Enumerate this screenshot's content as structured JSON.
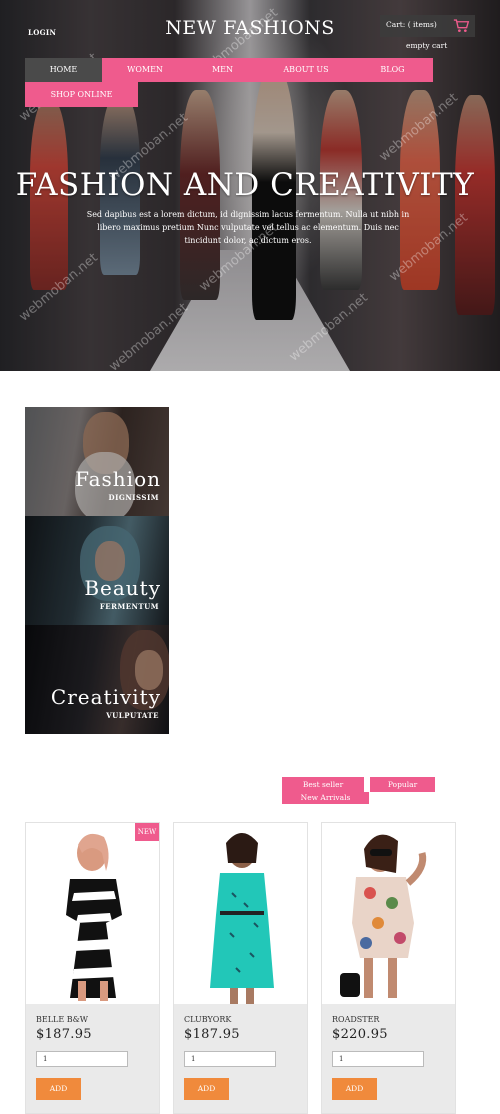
{
  "header": {
    "login": "LOGIN",
    "brand": "NEW FASHIONS",
    "cart_label": "Cart: ( items)",
    "cart_status": "empty cart"
  },
  "nav": {
    "items": [
      "HOME",
      "WOMEN",
      "MEN",
      "ABOUT US",
      "BLOG"
    ],
    "second_row": "SHOP ONLINE"
  },
  "hero": {
    "title": "FASHION AND CREATIVITY",
    "text": "Sed dapibus est a lorem dictum, id dignissim lacus fermentum. Nulla ut nibh in libero maximus pretium Nunc vulputate vel tellus ac elementum. Duis nec tincidunt dolor, ac dictum eros."
  },
  "categories": [
    {
      "title": "Fashion",
      "subtitle": "DIGNISSIM"
    },
    {
      "title": "Beauty",
      "subtitle": "FERMENTUM"
    },
    {
      "title": "Creativity",
      "subtitle": "VULPUTATE"
    }
  ],
  "tabs": {
    "best": "Best seller",
    "popular": "Popular",
    "new": "New Arrivals"
  },
  "products": [
    {
      "name": "BELLE B&W",
      "price": "$187.95",
      "qty": "1",
      "add": "ADD",
      "badge": "NEW"
    },
    {
      "name": "CLUBYORK",
      "price": "$187.95",
      "qty": "1",
      "add": "ADD"
    },
    {
      "name": "ROADSTER",
      "price": "$220.95",
      "qty": "1",
      "add": "ADD"
    }
  ],
  "watermark": "webmoban.net",
  "colors": {
    "accent": "#ef5b8d",
    "button": "#f08a3c",
    "nav_active": "#4a4a4a"
  }
}
